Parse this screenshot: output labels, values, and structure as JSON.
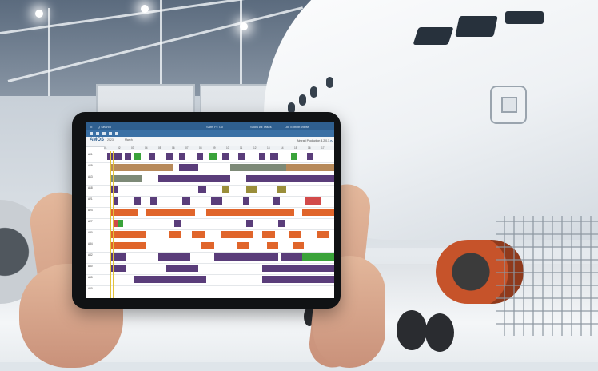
{
  "app": {
    "logo_text": "AMOS",
    "search_label": "Q Search",
    "center_label": "Sans Fil Tal",
    "top_right_a": "Show All Tasks",
    "top_right_b": "Old Exhibit Views",
    "title_right": "Aircraft Production 3.2.0.1",
    "month_label": "March",
    "year_label": "2023"
  },
  "timeline": {
    "dates": [
      "01",
      "02",
      "03",
      "04",
      "05",
      "06",
      "07",
      "08",
      "09",
      "10",
      "11",
      "12",
      "13",
      "14",
      "15",
      "16",
      "17"
    ]
  },
  "rows": [
    {
      "label": "A01"
    },
    {
      "label": "A09"
    },
    {
      "label": "A13"
    },
    {
      "label": "A18"
    },
    {
      "label": "A21"
    },
    {
      "label": "A24"
    },
    {
      "label": "A27"
    },
    {
      "label": "A30"
    },
    {
      "label": "A34"
    },
    {
      "label": "A42"
    },
    {
      "label": "A50"
    },
    {
      "label": "A55"
    },
    {
      "label": "A60"
    }
  ],
  "colors": {
    "app_bar": "#2f5f8f",
    "task_purple": "#5a3d7a",
    "task_orange": "#e0652b",
    "task_tan": "#b78a5a",
    "task_green": "#3aa33a",
    "task_olive": "#9a8e3a",
    "task_red": "#d24a4a",
    "task_gray": "#7d8a77",
    "today_line": "#e2c23b"
  }
}
